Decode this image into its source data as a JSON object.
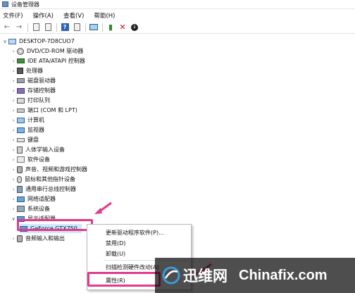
{
  "window": {
    "title": "设备管理器"
  },
  "menubar": [
    {
      "label": "文件(F)"
    },
    {
      "label": "操作(A)"
    },
    {
      "label": "查看(V)"
    },
    {
      "label": "帮助(H)"
    }
  ],
  "toolbar": {
    "buttons": [
      "back-icon",
      "forward-icon",
      "show-hide-icon",
      "properties-icon",
      "help-icon",
      "scan-hardware-icon",
      "enable-device-icon",
      "uninstall-icon",
      "update-driver-icon"
    ]
  },
  "tree": {
    "root": "DESKTOP-7D8CUO7",
    "categories": [
      {
        "label": "DVD/CD-ROM 驱动器",
        "icon": "disc-drive-icon"
      },
      {
        "label": "IDE ATA/ATAPI 控制器",
        "icon": "ide-controller-icon"
      },
      {
        "label": "处理器",
        "icon": "processor-icon"
      },
      {
        "label": "磁盘驱动器",
        "icon": "disk-drive-icon"
      },
      {
        "label": "存储控制器",
        "icon": "storage-controller-icon"
      },
      {
        "label": "打印队列",
        "icon": "print-queue-icon"
      },
      {
        "label": "端口 (COM 和 LPT)",
        "icon": "port-icon"
      },
      {
        "label": "计算机",
        "icon": "computer-icon"
      },
      {
        "label": "监视器",
        "icon": "monitor-icon"
      },
      {
        "label": "键盘",
        "icon": "keyboard-icon"
      },
      {
        "label": "人体学输入设备",
        "icon": "hid-icon"
      },
      {
        "label": "软件设备",
        "icon": "software-device-icon"
      },
      {
        "label": "声音、视频和游戏控制器",
        "icon": "sound-icon"
      },
      {
        "label": "鼠标和其他指针设备",
        "icon": "mouse-icon"
      },
      {
        "label": "通用串行总线控制器",
        "icon": "usb-icon"
      },
      {
        "label": "网络适配器",
        "icon": "network-adapter-icon"
      },
      {
        "label": "系统设备",
        "icon": "system-device-icon"
      },
      {
        "label": "显示适配器",
        "icon": "display-adapter-icon"
      }
    ],
    "expanded_child": "GeForce GTX750",
    "after": {
      "label": "音频输入和输出",
      "icon": "audio-io-icon"
    }
  },
  "context_menu": {
    "items": [
      {
        "label": "更新驱动程序软件(P)..."
      },
      {
        "label": "禁用(D)"
      },
      {
        "label": "卸载(U)"
      },
      {
        "label": "扫描检测硬件改动(A)"
      },
      {
        "label": "属性(R)"
      }
    ]
  },
  "watermark": {
    "cn": "迅维网",
    "en": "Chinafix.com"
  },
  "colors": {
    "highlight": "#e23a8c",
    "selection": "#cce8ff"
  }
}
